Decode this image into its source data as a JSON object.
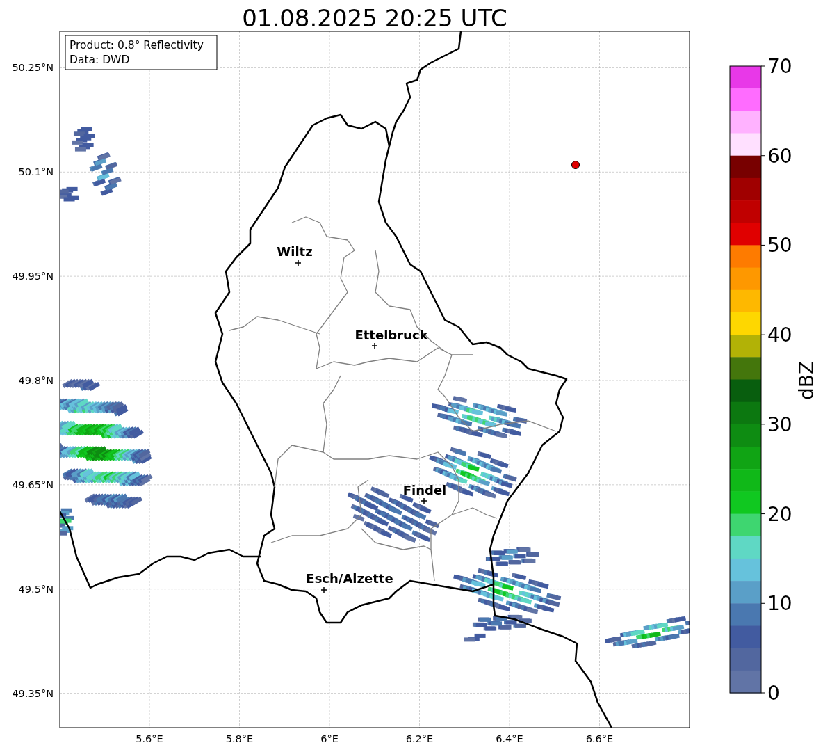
{
  "title": "01.08.2025 20:25 UTC",
  "info_box": [
    "Product: 0.8° Reflectivity",
    "Data: DWD"
  ],
  "y_ticks": [
    "50.25°N",
    "50.1°N",
    "49.95°N",
    "49.8°N",
    "49.65°N",
    "49.5°N",
    "49.35°N"
  ],
  "x_ticks": [
    "5.6°E",
    "5.8°E",
    "6°E",
    "6.2°E",
    "6.4°E",
    "6.6°E"
  ],
  "cities": [
    {
      "name": "Wiltz"
    },
    {
      "name": "Ettelbruck"
    },
    {
      "name": "Findel"
    },
    {
      "name": "Esch/Alzette"
    }
  ],
  "colorbar": {
    "label": "dBZ",
    "ticks": [
      "70",
      "60",
      "50",
      "40",
      "30",
      "20",
      "10",
      "0"
    ],
    "bins": [
      {
        "color": "#e838e8"
      },
      {
        "color": "#ff6cff"
      },
      {
        "color": "#ffb2ff"
      },
      {
        "color": "#ffe0ff"
      },
      {
        "color": "#780000"
      },
      {
        "color": "#a00000"
      },
      {
        "color": "#c00000"
      },
      {
        "color": "#e00000"
      },
      {
        "color": "#fe7b00"
      },
      {
        "color": "#fe9800"
      },
      {
        "color": "#feb800"
      },
      {
        "color": "#fed700"
      },
      {
        "color": "#b2b206"
      },
      {
        "color": "#44760c"
      },
      {
        "color": "#085e0e"
      },
      {
        "color": "#0c7810"
      },
      {
        "color": "#0e8c12"
      },
      {
        "color": "#10a414"
      },
      {
        "color": "#10b818"
      },
      {
        "color": "#10c820"
      },
      {
        "color": "#3ed670"
      },
      {
        "color": "#5fd8c4"
      },
      {
        "color": "#66c2dc"
      },
      {
        "color": "#5a9fc8"
      },
      {
        "color": "#4a78b0"
      },
      {
        "color": "#425ba0"
      },
      {
        "color": "#52679f"
      },
      {
        "color": "#6174a6"
      }
    ]
  }
}
